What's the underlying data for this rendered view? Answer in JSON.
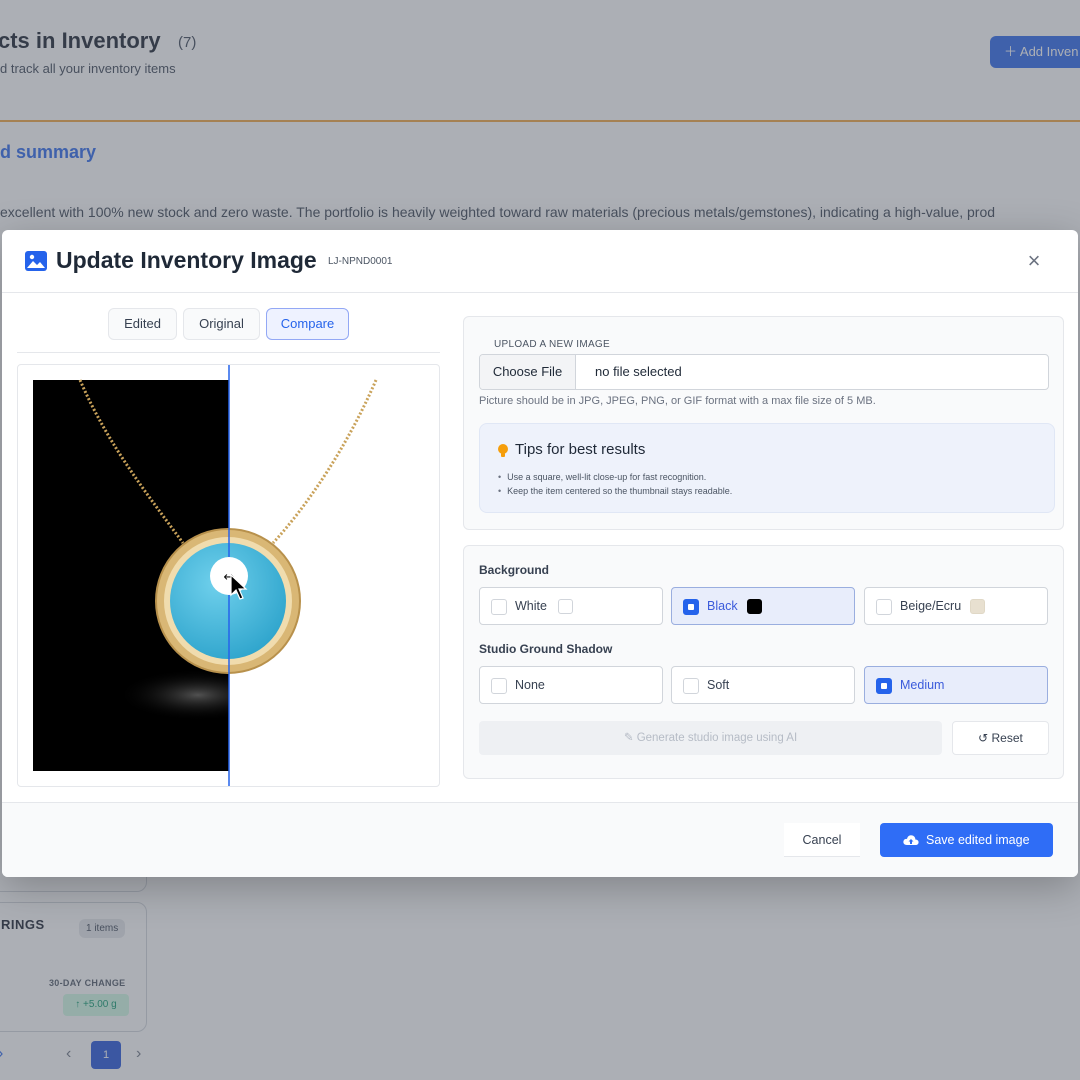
{
  "background_page": {
    "title": "cts in Inventory",
    "count": "(7)",
    "subtitle": "d track all your inventory items",
    "add_button": "Add Inven",
    "summary_title": "d summary",
    "summary_text": "excellent with 100% new stock and zero waste. The portfolio is heavily weighted toward raw materials (precious metals/gemstones), indicating a high-value, prod",
    "card": {
      "title": "RINGS",
      "badge": "1 items",
      "change_label": "30-DAY CHANGE",
      "change_value": "↑ +5.00 g"
    },
    "pagination": {
      "current_page": "1",
      "prev": "‹",
      "next": "›"
    }
  },
  "modal": {
    "title": "Update Inventory Image",
    "sku": "LJ-NPND0001",
    "close_label": "×",
    "view_tabs": [
      {
        "label": "Edited",
        "active": false
      },
      {
        "label": "Original",
        "active": false
      },
      {
        "label": "Compare",
        "active": true
      }
    ],
    "upload": {
      "label": "UPLOAD A NEW IMAGE",
      "choose_button": "Choose File",
      "file_status": "no file selected",
      "hint": "Picture should be in JPG, JPEG, PNG, or GIF format with a max file size of 5 MB."
    },
    "tips": {
      "title": "Tips for best results",
      "items": [
        "Use a square, well-lit close-up for fast recognition.",
        "Keep the item centered so the thumbnail stays readable."
      ]
    },
    "background": {
      "label": "Background",
      "options": [
        {
          "label": "White",
          "swatch": "#ffffff",
          "selected": false
        },
        {
          "label": "Black",
          "swatch": "#000000",
          "selected": true
        },
        {
          "label": "Beige/Ecru",
          "swatch": "#e8e0d0",
          "selected": false
        }
      ]
    },
    "shadow": {
      "label": "Studio Ground Shadow",
      "options": [
        {
          "label": "None",
          "selected": false
        },
        {
          "label": "Soft",
          "selected": false
        },
        {
          "label": "Medium",
          "selected": true
        }
      ]
    },
    "generate_button": "Generate studio image using AI",
    "reset_button": "Reset",
    "cancel_button": "Cancel",
    "save_button": "Save edited image",
    "compare_split": 0.46
  },
  "colors": {
    "accent": "#2563eb",
    "save_button": "#2f6df6",
    "turquoise": "#3fb6d8",
    "gold": "#d4b06a"
  }
}
